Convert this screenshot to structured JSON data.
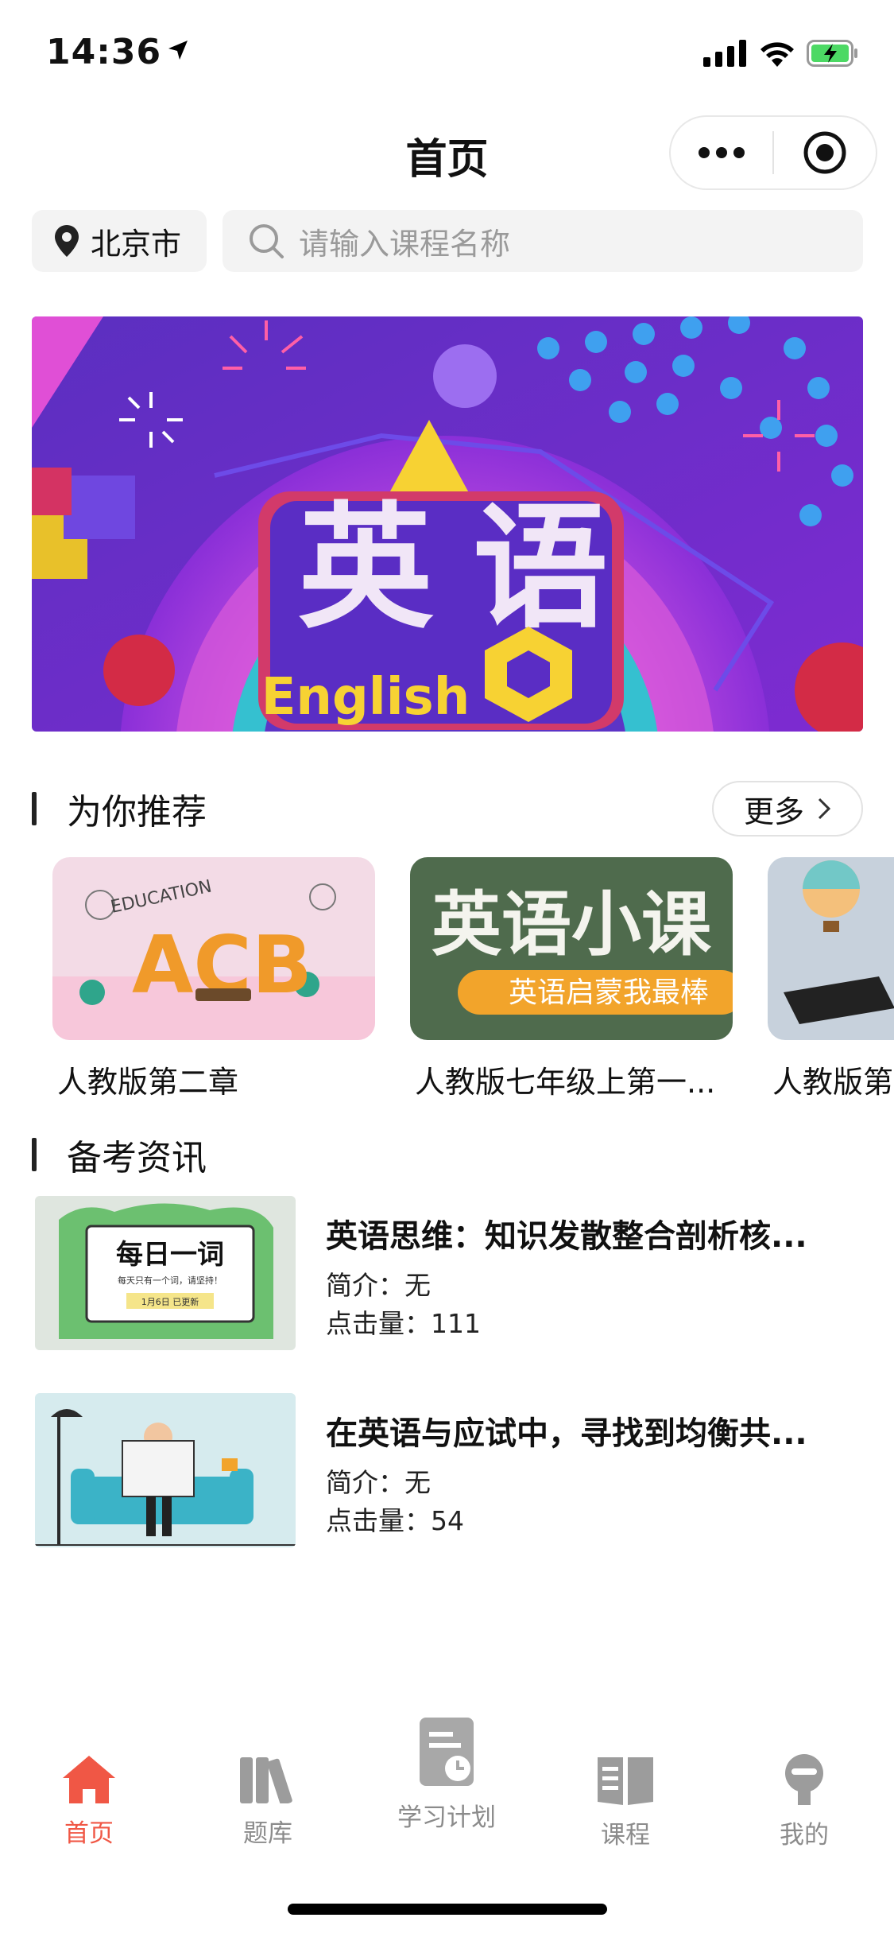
{
  "status_bar": {
    "time": "14:36"
  },
  "nav": {
    "title": "首页"
  },
  "search": {
    "city": "北京市",
    "placeholder": "请输入课程名称"
  },
  "banner": {
    "main_text": "英语",
    "sub_text": "English"
  },
  "recommend": {
    "heading": "为你推荐",
    "more_label": "更多",
    "items": [
      {
        "title": "人教版第二章",
        "thumb_text": "ACB",
        "thumb_caption": "EDUCATION"
      },
      {
        "title": "人教版七年级上第一...",
        "thumb_text": "英语小课",
        "thumb_caption": "英语启蒙我最棒"
      },
      {
        "title": "人教版第"
      }
    ]
  },
  "news": {
    "heading": "备考资讯",
    "items": [
      {
        "title": "英语思维：知识发散整合剖析核...",
        "intro": "简介：无",
        "clicks": "点击量：111",
        "thumb_title": "每日一词",
        "thumb_sub": "每天只有一个词，请坚持！",
        "thumb_tag": "1月6日 已更新"
      },
      {
        "title": "在英语与应试中，寻找到均衡共...",
        "intro": "简介：无",
        "clicks": "点击量：54"
      }
    ]
  },
  "tabbar": {
    "active_color": "#f05745",
    "inactive_color": "#8b8b8b",
    "items": [
      {
        "label": "首页",
        "icon": "home-icon"
      },
      {
        "label": "题库",
        "icon": "books-icon"
      },
      {
        "label": "学习计划",
        "icon": "plan-icon"
      },
      {
        "label": "课程",
        "icon": "course-book-icon"
      },
      {
        "label": "我的",
        "icon": "profile-icon"
      }
    ]
  }
}
